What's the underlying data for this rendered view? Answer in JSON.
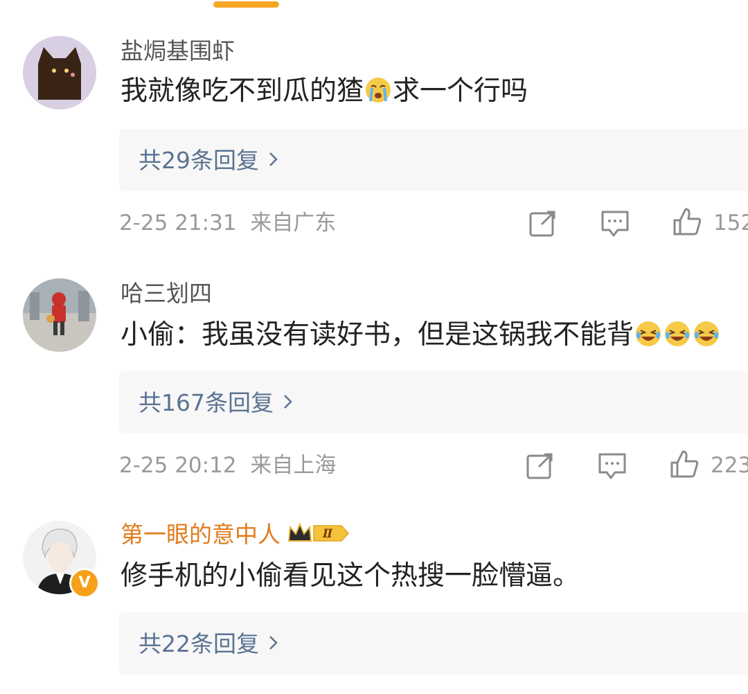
{
  "comments": [
    {
      "username": "盐焗基围虾",
      "text_before": "我就像吃不到瓜的猹",
      "text_after": "求一个行吗",
      "emoji": "crying-emoji",
      "replies_label": "共29条回复",
      "timestamp": "2-25 21:31",
      "location": "来自广东",
      "likes": "152"
    },
    {
      "username": "哈三划四",
      "text_before": "小偷：我虽没有读好书，但是这锅我不能背",
      "text_after": "",
      "emoji": "laughing-crying-emoji",
      "replies_label": "共167条回复",
      "timestamp": "2-25 20:12",
      "location": "来自上海",
      "likes": "223"
    },
    {
      "username": "第一眼的意中人",
      "badge": "Ⅱ",
      "verified_mark": "V",
      "text_before": "修手机的小偷看见这个热搜一脸懵逼。",
      "text_after": "",
      "replies_label": "共22条回复"
    }
  ],
  "colors": {
    "accent": "#f5a623",
    "reply_link": "#5a7392",
    "vip_name": "#e07b1d",
    "meta": "#9a9a9a"
  },
  "icons": [
    "share-icon",
    "comment-icon",
    "like-icon",
    "chevron-right-icon",
    "crown-icon",
    "verified-icon"
  ]
}
